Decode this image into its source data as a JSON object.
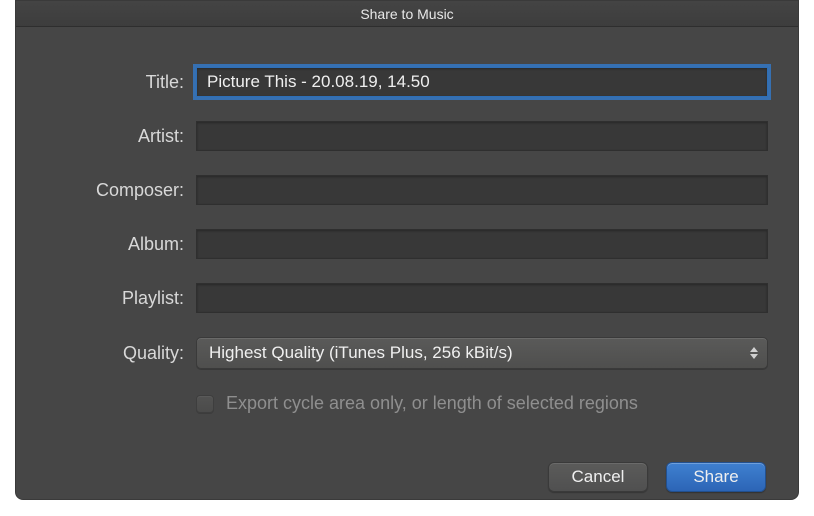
{
  "window": {
    "title": "Share to Music"
  },
  "form": {
    "title_label": "Title:",
    "title_value": "Picture This - 20.08.19, 14.50",
    "artist_label": "Artist:",
    "artist_value": "",
    "composer_label": "Composer:",
    "composer_value": "",
    "album_label": "Album:",
    "album_value": "",
    "playlist_label": "Playlist:",
    "playlist_value": "",
    "quality_label": "Quality:",
    "quality_value": "Highest Quality (iTunes Plus, 256 kBit/s)"
  },
  "checkbox": {
    "label": "Export cycle area only, or length of selected regions",
    "checked": false
  },
  "buttons": {
    "cancel": "Cancel",
    "share": "Share"
  }
}
